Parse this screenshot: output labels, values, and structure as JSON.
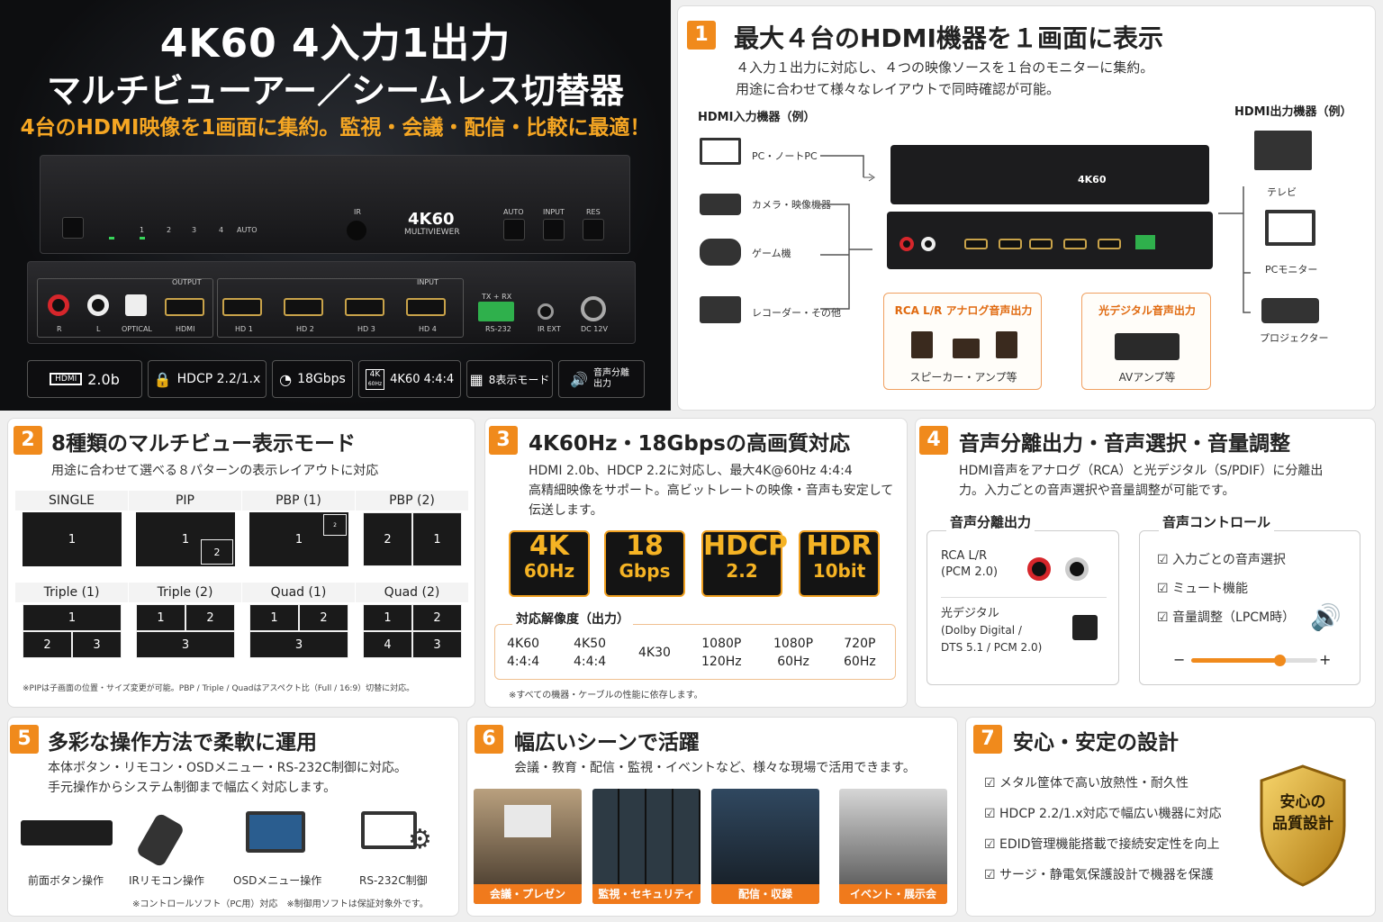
{
  "hero": {
    "title1": "4K60 4入力1出力",
    "title2": "マルチビューアー／シームレス切替器",
    "subtitle": "4台のHDMI映像を1画面に集約。監視・会議・配信・比較に最適！",
    "front_labels": {
      "ir": "IR",
      "model": "4K60",
      "model_sub": "MULTIVIEWER",
      "auto_btn": "AUTO",
      "input_btn": "INPUT",
      "res_btn": "RES",
      "led1": "1",
      "led2": "2",
      "led3": "3",
      "led4": "4",
      "led_auto": "AUTO"
    },
    "rear_labels": {
      "output": "OUTPUT",
      "input": "INPUT",
      "r": "R",
      "l": "L",
      "optical": "OPTICAL",
      "hdmi": "HDMI",
      "hd1": "HD 1",
      "hd2": "HD 2",
      "hd3": "HD 3",
      "hd4": "HD 4",
      "txrx": "TX + RX",
      "rs232": "RS-232",
      "irext": "IR EXT",
      "dc": "DC 12V"
    },
    "specs": [
      "2.0b",
      "HDCP 2.2/1.x",
      "18Gbps",
      "4K60 4:4:4",
      "8表示モード",
      "音声分離出力"
    ],
    "spec_icon_text": {
      "hdmi": "HDMI",
      "k4": "4K",
      "k4sub": "60Hz"
    }
  },
  "sec1": {
    "num": "1",
    "title": "最大４台のHDMI機器を１画面に表示",
    "text1": "４入力１出力に対応し、４つの映像ソースを１台のモニターに集約。",
    "text2": "用途に合わせて様々なレイアウトで同時確認が可能。",
    "input_head": "HDMI入力機器（例）",
    "output_head": "HDMI出力機器（例）",
    "inputs": [
      "PC・ノートPC",
      "カメラ・映像機器",
      "ゲーム機",
      "レコーダー・その他"
    ],
    "outputs": [
      "テレビ",
      "PCモニター",
      "プロジェクター"
    ],
    "rca_box": {
      "title": "RCA L/R アナログ音声出力",
      "label": "スピーカー・アンプ等"
    },
    "opt_box": {
      "title": "光デジタル音声出力",
      "label": "AVアンプ等"
    }
  },
  "sec2": {
    "num": "2",
    "title": "8種類のマルチビュー表示モード",
    "text": "用途に合わせて選べる８パターンの表示レイアウトに対応",
    "modes": [
      "SINGLE",
      "PIP",
      "PBP (1)",
      "PBP (2)",
      "Triple (1)",
      "Triple (2)",
      "Quad (1)",
      "Quad (2)"
    ],
    "note": "※PIPは子画面の位置・サイズ変更が可能。PBP / Triple / Quadはアスペクト比（Full / 16:9）切替に対応。"
  },
  "sec3": {
    "num": "3",
    "title": "4K60Hz・18Gbpsの高画質対応",
    "text1": "HDMI 2.0b、HDCP 2.2に対応し、最大4K@60Hz 4:4:4",
    "text2": "高精細映像をサポート。高ビットレートの映像・音声も安定して",
    "text3": "伝送します。",
    "badges": [
      {
        "top": "4K",
        "bottom": "60Hz"
      },
      {
        "top": "18",
        "bottom": "Gbps"
      },
      {
        "top": "HDCP",
        "bottom": "2.2"
      },
      {
        "top": "HDR",
        "bottom": "10bit"
      }
    ],
    "res_head": "対応解像度（出力）",
    "resolutions": [
      [
        "4K60",
        "4:4:4"
      ],
      [
        "4K50",
        "4:4:4"
      ],
      [
        "4K30",
        ""
      ],
      [
        "1080P",
        "120Hz"
      ],
      [
        "1080P",
        "60Hz"
      ],
      [
        "720P",
        "60Hz"
      ]
    ],
    "note": "※すべての機器・ケーブルの性能に依存します。"
  },
  "sec4": {
    "num": "4",
    "title": "音声分離出力・音声選択・音量調整",
    "text1": "HDMI音声をアナログ（RCA）と光デジタル（S/PDIF）に分離出",
    "text2": "力。入力ごとの音声選択や音量調整が可能です。",
    "sep_head": "音声分離出力",
    "ctrl_head": "音声コントロール",
    "rca1": "RCA L/R",
    "rca2": "(PCM 2.0)",
    "opt1": "光デジタル",
    "opt2": "(Dolby Digital /",
    "opt3": "DTS 5.1 / PCM 2.0)",
    "checks": [
      "入力ごとの音声選択",
      "ミュート機能",
      "音量調整（LPCM時）"
    ],
    "volume": 0.7,
    "minus": "−",
    "plus": "+"
  },
  "sec5": {
    "num": "5",
    "title": "多彩な操作方法で柔軟に運用",
    "text1": "本体ボタン・リモコン・OSDメニュー・RS-232C制御に対応。",
    "text2": "手元操作からシステム制御まで幅広く対応します。",
    "items": [
      "前面ボタン操作",
      "IRリモコン操作",
      "OSDメニュー操作",
      "RS-232C制御"
    ],
    "note": "※コントロールソフト（PC用）対応　※制御用ソフトは保証対象外です。"
  },
  "sec6": {
    "num": "6",
    "title": "幅広いシーンで活躍",
    "text": "会議・教育・配信・監視・イベントなど、様々な現場で活用できます。",
    "scenes": [
      "会議・プレゼン",
      "監視・セキュリティ",
      "配信・収録",
      "イベント・展示会"
    ]
  },
  "sec7": {
    "num": "7",
    "title": "安心・安定の設計",
    "checks": [
      "メタル筐体で高い放熱性・耐久性",
      "HDCP 2.2/1.x対応で幅広い機器に対応",
      "EDID管理機能搭載で接続安定性を向上",
      "サージ・静電気保護設計で機器を保護"
    ],
    "shield1": "安心の",
    "shield2": "品質設計"
  },
  "colors": {
    "accent": "#f08a1c",
    "gold": "#f5a623"
  }
}
